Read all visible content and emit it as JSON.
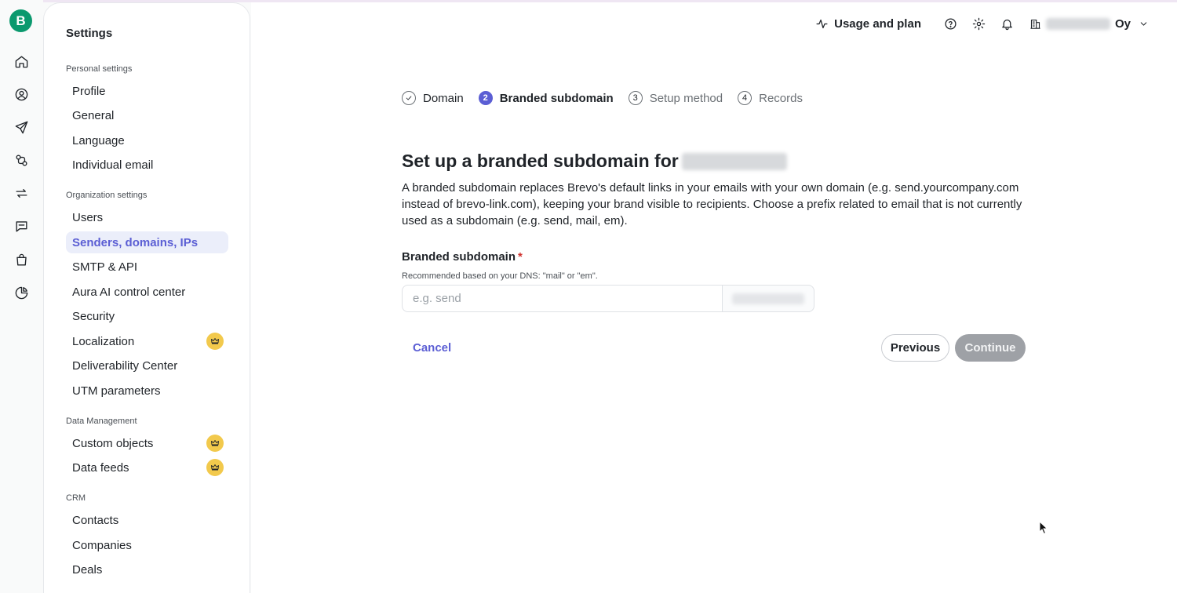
{
  "rail": {
    "logo": "B",
    "items": [
      "home-icon",
      "contacts-icon",
      "campaigns-icon",
      "automations-icon",
      "transactional-icon",
      "conversations-icon",
      "sales-icon",
      "analytics-icon"
    ]
  },
  "settings": {
    "title": "Settings",
    "sections": [
      {
        "label": "Personal settings",
        "items": [
          "Profile",
          "General",
          "Language",
          "Individual email"
        ]
      },
      {
        "label": "Organization settings",
        "items": [
          "Users",
          "Senders, domains, IPs",
          "SMTP & API",
          "Aura AI control center",
          "Security",
          "Localization",
          "Deliverability Center",
          "UTM parameters"
        ]
      },
      {
        "label": "Data Management",
        "items": [
          "Custom objects",
          "Data feeds"
        ]
      },
      {
        "label": "CRM",
        "items": [
          "Contacts",
          "Companies",
          "Deals"
        ]
      }
    ],
    "active_item": "Senders, domains, IPs",
    "premium_items": [
      "Localization",
      "Custom objects",
      "Data feeds"
    ]
  },
  "topbar": {
    "usage_label": "Usage and plan",
    "org_suffix": "Oy",
    "icons": [
      "help-icon",
      "gear-icon",
      "bell-icon"
    ]
  },
  "stepper": {
    "steps": [
      {
        "number": "1",
        "label": "Domain",
        "state": "done"
      },
      {
        "number": "2",
        "label": "Branded subdomain",
        "state": "current"
      },
      {
        "number": "3",
        "label": "Setup method",
        "state": "upcoming"
      },
      {
        "number": "4",
        "label": "Records",
        "state": "upcoming"
      }
    ]
  },
  "form": {
    "title": "Set up a branded subdomain for",
    "description": "A branded subdomain replaces Brevo's default links in your emails with your own domain (e.g. send.yourcompany.com instead of brevo-link.com), keeping your brand visible to recipients. Choose a prefix related to email that is not currently used as a subdomain (e.g. send, mail, em).",
    "field_label": "Branded subdomain",
    "required_mark": "*",
    "hint": "Recommended based on your DNS: \"mail\" or \"em\".",
    "placeholder": "e.g. send",
    "value": ""
  },
  "actions": {
    "cancel": "Cancel",
    "previous": "Previous",
    "continue": "Continue"
  },
  "colors": {
    "accent": "#5b5ed4",
    "brand": "#0b996e",
    "premium": "#f2c94c",
    "required": "#d0312d"
  }
}
